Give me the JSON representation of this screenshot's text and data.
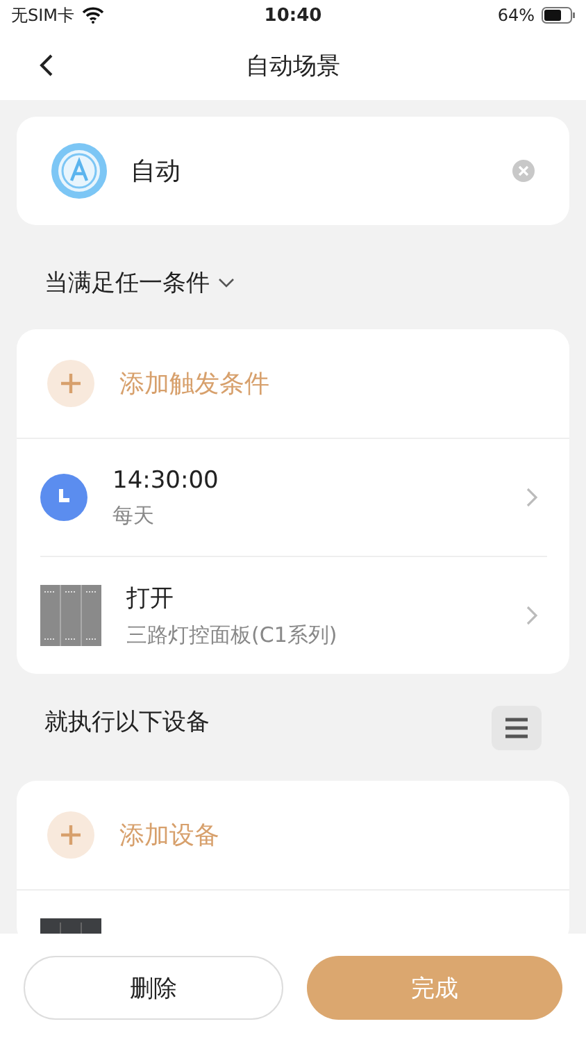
{
  "status_bar": {
    "carrier": "无SIM卡",
    "time": "10:40",
    "battery": "64%"
  },
  "nav": {
    "title": "自动场景"
  },
  "scene": {
    "name": "自动"
  },
  "conditions": {
    "heading": "当满足任一条件",
    "add_label": "添加触发条件",
    "items": [
      {
        "kind": "time",
        "title": "14:30:00",
        "subtitle": "每天"
      },
      {
        "kind": "device",
        "title": "打开",
        "subtitle": "三路灯控面板(C1系列)"
      }
    ]
  },
  "actions": {
    "heading": "就执行以下设备",
    "add_label": "添加设备",
    "items": [
      {
        "kind": "device"
      }
    ]
  },
  "footer": {
    "delete_label": "删除",
    "done_label": "完成"
  }
}
